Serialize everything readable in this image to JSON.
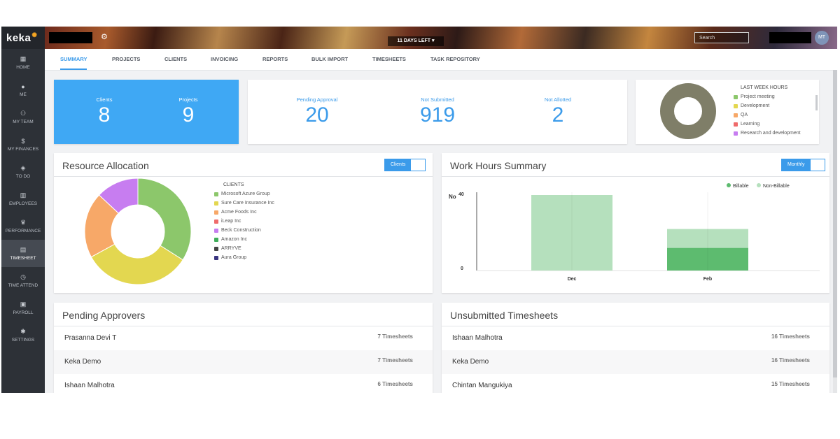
{
  "brand": {
    "name": "keka"
  },
  "header": {
    "days_left": "11 DAYS LEFT",
    "search_placeholder": "Search",
    "avatar_initials": "MT"
  },
  "sidebar": {
    "items": [
      {
        "label": "HOME",
        "icon": "home-icon",
        "glyph": "▦"
      },
      {
        "label": "ME",
        "icon": "user-icon",
        "glyph": "●"
      },
      {
        "label": "MY TEAM",
        "icon": "team-icon",
        "glyph": "⚇"
      },
      {
        "label": "MY FINANCES",
        "icon": "finance-icon",
        "glyph": "$"
      },
      {
        "label": "TO DO",
        "icon": "todo-icon",
        "glyph": "◈"
      },
      {
        "label": "EMPLOYEES",
        "icon": "employees-icon",
        "glyph": "▥"
      },
      {
        "label": "PERFORMANCE",
        "icon": "trophy-icon",
        "glyph": "♛"
      },
      {
        "label": "TIMESHEET",
        "icon": "timesheet-icon",
        "glyph": "▤"
      },
      {
        "label": "TIME ATTEND",
        "icon": "clock-icon",
        "glyph": "◷"
      },
      {
        "label": "PAYROLL",
        "icon": "payroll-icon",
        "glyph": "▣"
      },
      {
        "label": "SETTINGS",
        "icon": "settings-icon",
        "glyph": "✱"
      }
    ],
    "active": "TIMESHEET"
  },
  "tabs": [
    "SUMMARY",
    "PROJECTS",
    "CLIENTS",
    "INVOICING",
    "REPORTS",
    "BULK IMPORT",
    "TIMESHEETS",
    "TASK REPOSITORY"
  ],
  "stats": {
    "clients_label": "Clients",
    "clients_value": "8",
    "projects_label": "Projects",
    "projects_value": "9",
    "pending_label": "Pending Approval",
    "pending_value": "20",
    "not_submitted_label": "Not Submitted",
    "not_submitted_value": "919",
    "not_allotted_label": "Not Allotted",
    "not_allotted_value": "2"
  },
  "last_week": {
    "title": "LAST WEEK HOURS",
    "items": [
      {
        "label": "Project meeting",
        "color": "#8cc76b"
      },
      {
        "label": "Development",
        "color": "#e3d750"
      },
      {
        "label": "QA",
        "color": "#f7a868"
      },
      {
        "label": "Learning",
        "color": "#ef6b6b"
      },
      {
        "label": "Research and development",
        "color": "#c77df0"
      }
    ],
    "donut_color": "#7f7e68"
  },
  "resource_allocation": {
    "title": "Resource Allocation",
    "toggle_label": "Clients",
    "legend_title": "CLIENTS",
    "clients": [
      {
        "label": "Microsoft Azure Group",
        "color": "#8cc76b"
      },
      {
        "label": "Sure Care Insurance Inc",
        "color": "#e3d750"
      },
      {
        "label": "Acme Foods Inc",
        "color": "#f7a868"
      },
      {
        "label": "iLeap Inc",
        "color": "#ef6b6b"
      },
      {
        "label": "Beck Construction",
        "color": "#c77df0"
      },
      {
        "label": "Amazon Inc",
        "color": "#3fae5a"
      },
      {
        "label": "ARRYVE",
        "color": "#444444"
      },
      {
        "label": "Aura Group",
        "color": "#3a3580"
      }
    ]
  },
  "chart_data": [
    {
      "type": "pie",
      "categories": [
        "Microsoft Azure Group",
        "Sure Care Insurance Inc",
        "Acme Foods Inc",
        "Beck Construction"
      ],
      "values": [
        34,
        33,
        20,
        13
      ],
      "colors": [
        "#8cc76b",
        "#e3d750",
        "#f7a868",
        "#c77df0"
      ]
    },
    {
      "type": "bar",
      "title": "Work Hours Summary",
      "categories": [
        "Dec",
        "Feb"
      ],
      "series": [
        {
          "name": "Billable",
          "values": [
            0,
            12
          ],
          "color": "#5dbb6f"
        },
        {
          "name": "Non-Billable",
          "values": [
            40,
            10
          ],
          "color": "#b5e0bd"
        }
      ],
      "ylabel": "No",
      "yticks": [
        "0",
        "40"
      ],
      "ylim": [
        0,
        40
      ],
      "legend": "top-right"
    }
  ],
  "work_hours": {
    "title": "Work Hours Summary",
    "toggle_label": "Monthly"
  },
  "pending_approvers": {
    "title": "Pending Approvers",
    "rows": [
      {
        "name": "Prasanna Devi T",
        "count": "7 Timesheets"
      },
      {
        "name": "Keka Demo",
        "count": "7 Timesheets"
      },
      {
        "name": "Ishaan Malhotra",
        "count": "6 Timesheets"
      }
    ]
  },
  "unsubmitted": {
    "title": "Unsubmitted Timesheets",
    "rows": [
      {
        "name": "Ishaan Malhotra",
        "count": "16 Timesheets"
      },
      {
        "name": "Keka Demo",
        "count": "16 Timesheets"
      },
      {
        "name": "Chintan Mangukiya",
        "count": "15 Timesheets"
      }
    ]
  }
}
